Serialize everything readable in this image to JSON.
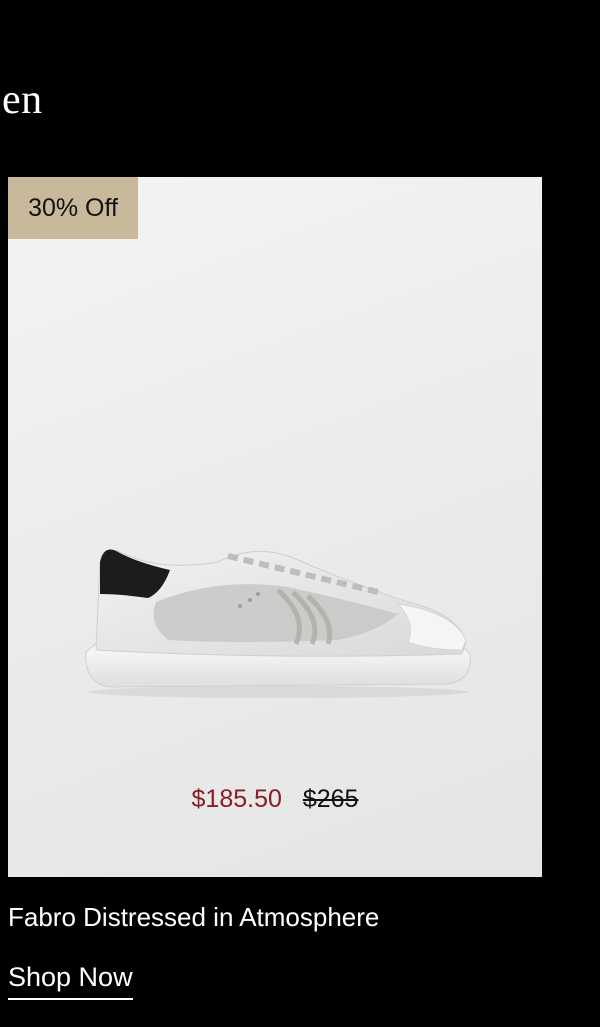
{
  "header": {
    "heading_fragment": "en"
  },
  "product": {
    "badge": "30% Off",
    "sale_price": "$185.50",
    "original_price": "$265",
    "name": "Fabro Distressed in Atmosphere",
    "cta": "Shop Now",
    "image": "white-distressed-sneaker",
    "colors": {
      "badge_bg": "#c9b99b",
      "sale_price": "#8a1c24",
      "card_bg": "#ececec",
      "page_bg": "#000000"
    }
  }
}
